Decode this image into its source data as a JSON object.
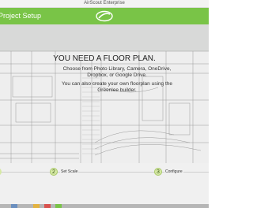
{
  "window": {
    "title": "AirScout Enterprise"
  },
  "header": {
    "title": "Project Setup"
  },
  "prompt": {
    "headline": "YOU NEED A FLOOR PLAN.",
    "line1": "Choose from Photo Library, Camera, OneDrive, Dropbox, or Google Drive.",
    "line2": "You can also create your own floorplan using the Greenlee builder."
  },
  "steps": [
    {
      "number": "2",
      "label": "Set Scale"
    },
    {
      "number": "3",
      "label": "Configure"
    }
  ],
  "colors": {
    "header_green": "#79c447",
    "step_circle": "#d6e9a4"
  }
}
